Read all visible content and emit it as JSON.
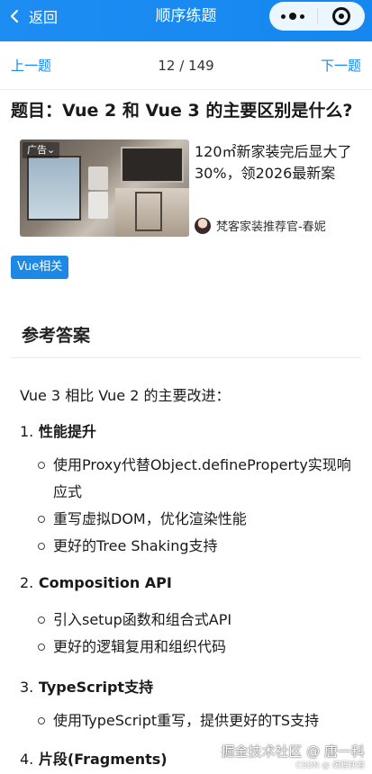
{
  "navbar": {
    "back_label": "返回",
    "title": "顺序练题"
  },
  "pager": {
    "prev_label": "上一题",
    "count": "12 / 149",
    "next_label": "下一题"
  },
  "question": {
    "title": "题目：Vue 2 和 Vue 3 的主要区别是什么?"
  },
  "ad": {
    "badge": "广告⌄",
    "text": "120㎡新家装完后显大了30%，领2026最新案",
    "author": "梵客家装推荐官-春妮"
  },
  "tag": "Vue相关",
  "answer": {
    "heading": "参考答案",
    "intro": "Vue 3 相比 Vue 2 的主要改进：",
    "sections": [
      {
        "num": "1.",
        "title": "性能提升",
        "items": [
          "使用Proxy代替Object.defineProperty实现响应式",
          "重写虚拟DOM，优化渲染性能",
          "更好的Tree Shaking支持"
        ]
      },
      {
        "num": "2.",
        "title": "Composition API",
        "items": [
          "引入setup函数和组合式API",
          "更好的逻辑复用和组织代码"
        ]
      },
      {
        "num": "3.",
        "title": "TypeScript支持",
        "items": [
          "使用TypeScript重写，提供更好的TS支持"
        ]
      },
      {
        "num": "4.",
        "title": "片段(Fragments)",
        "items": []
      }
    ]
  },
  "watermark": {
    "line1": "掘金技术社区 @ 唐一科",
    "line2": "CSDN @ 编程侠君"
  },
  "colors": {
    "navbar": "#1487f0",
    "accent": "#1e88e5"
  }
}
